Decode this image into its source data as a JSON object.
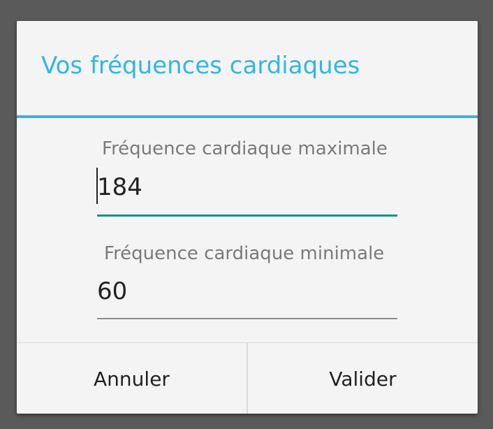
{
  "dialog": {
    "title": "Vos fréquences cardiaques",
    "accent_color": "#33b5e5",
    "fields": [
      {
        "label": "Fréquence cardiaque maximale",
        "value": "184",
        "focused": true
      },
      {
        "label": "Fréquence cardiaque minimale",
        "value": "60",
        "focused": false
      }
    ],
    "buttons": {
      "cancel_label": "Annuler",
      "confirm_label": "Valider"
    }
  }
}
